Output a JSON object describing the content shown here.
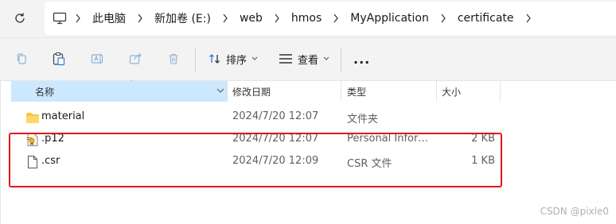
{
  "breadcrumbs": [
    "此电脑",
    "新加卷 (E:)",
    "web",
    "hmos",
    "MyApplication",
    "certificate"
  ],
  "toolbar": {
    "sort_label": "排序",
    "view_label": "查看",
    "more_label": "..."
  },
  "columns": {
    "name": "名称",
    "date": "修改日期",
    "type": "类型",
    "size": "大小"
  },
  "files": [
    {
      "name": "material",
      "date": "2024/7/20 12:07",
      "type": "文件夹",
      "size": "",
      "icon": "folder-icon"
    },
    {
      "name": ".p12",
      "date": "2024/7/20 12:07",
      "type": "Personal Information Exchange",
      "size": "2 KB",
      "icon": "certificate-file-icon"
    },
    {
      "name": ".csr",
      "date": "2024/7/20 12:09",
      "type": "CSR 文件",
      "size": "1 KB",
      "icon": "file-icon"
    }
  ],
  "watermark": "CSDN @pixle0",
  "colors": {
    "accent": "#cce8ff",
    "highlight_border": "#e3161e",
    "folder": "#f5c542"
  }
}
